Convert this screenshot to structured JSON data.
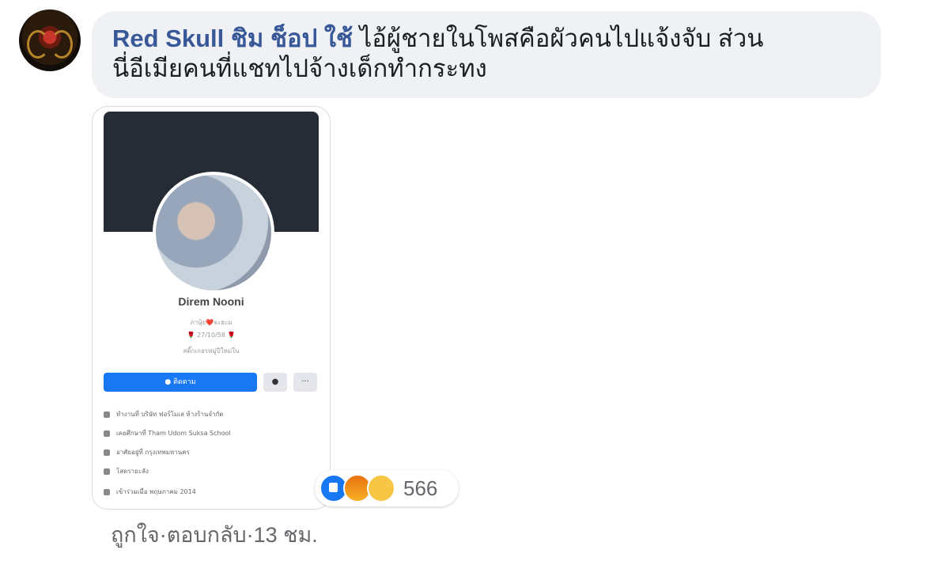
{
  "comment": {
    "author": "Red Skull ชิม ช็อป ใช้",
    "text_line1": "ไอ้ผู้ชายในโพสคือผัวคนไปแจ้งจับ ส่วน",
    "text_line2": "นี่อีเมียคนที่แชทไปจ้างเด็กทำกระทง"
  },
  "profile_card": {
    "name": "Direm Nooni",
    "line1": "ภาษุ้ย❤️จะฮะม",
    "line2": "🌹 27/10/58 🌹",
    "line3": "สติ๊กเกอรหมู่ปีใหม่ใน",
    "primary_button": "● ติดตาม",
    "messenger_icon": "●",
    "more_button": "···",
    "info": [
      "ทำงานที่ บริษัท ฟอร์โมเล่ ห้างร้านจำกัด",
      "เคยศึกษาที่ Tham Udom Suksa School",
      "อาศัยอยู่ที่ กรุงเทพมหานคร",
      "โสดรายะลัง",
      "เข้าร่วมเมื่อ พฤษภาคม 2014"
    ]
  },
  "reactions": {
    "count": "566"
  },
  "actions": {
    "like": "ถูกใจ",
    "separator": " · ",
    "reply": "ตอบกลับ",
    "time": "13 ชม."
  },
  "colors": {
    "author": "#385898",
    "bubble": "#eff1f4",
    "primary": "#1877f2"
  }
}
